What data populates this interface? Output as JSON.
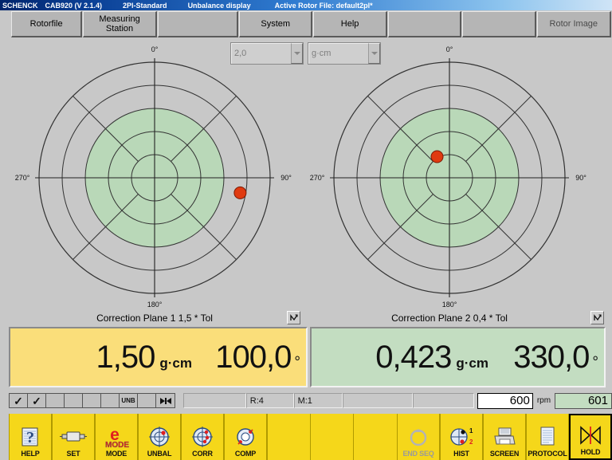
{
  "titlebar": {
    "brand": "SCHENCK",
    "app": "CAB920 (V 2.1.4)",
    "standard": "2Pl-Standard",
    "mode": "Unbalance display",
    "file": "Active Rotor File: default2pl*"
  },
  "menu": {
    "items": [
      {
        "label": "Rotorfile",
        "enabled": true
      },
      {
        "label": "Measuring\nStation",
        "enabled": true
      },
      {
        "label": "",
        "enabled": false
      },
      {
        "label": "System",
        "enabled": true
      },
      {
        "label": "Help",
        "enabled": true
      },
      {
        "label": "",
        "enabled": false
      },
      {
        "label": "",
        "enabled": false
      },
      {
        "label": "Rotor Image",
        "enabled": true
      }
    ]
  },
  "toolbar_top": {
    "tolerance_select": {
      "value": "2,0",
      "icon": "chevron-down-icon"
    },
    "unit_select": {
      "value": "g·cm",
      "icon": "chevron-down-icon"
    }
  },
  "plots": {
    "plane1": {
      "caption": "Correction Plane 1   1,5 * Tol",
      "labels": {
        "top": "0°",
        "right": "90°",
        "bottom": "180°",
        "left": "270°"
      },
      "trend_icon": "trend-chart-icon"
    },
    "plane2": {
      "caption": "Correction Plane 2   0,4 * Tol",
      "labels": {
        "top": "0°",
        "right": "90°",
        "bottom": "180°",
        "left": "270°"
      },
      "trend_icon": "trend-chart-icon"
    }
  },
  "readouts": {
    "plane1": {
      "amount": "1,50",
      "unit": "g·cm",
      "angle": "100,0",
      "degree": "°",
      "color": "#fade7a"
    },
    "plane2": {
      "amount": "0,423",
      "unit": "g·cm",
      "angle": "330,0",
      "degree": "°",
      "color": "#c3ddc1"
    }
  },
  "statusbar": {
    "cells": [
      "✓",
      "✓",
      "",
      "",
      "",
      "",
      "UNB",
      "",
      "▶◀"
    ],
    "blank1": "",
    "run": "R:4",
    "measurement": "M:1",
    "blank2": "",
    "blank3": "",
    "rpm_setpoint": "600",
    "rpm_label": "rpm",
    "rpm_actual": "601"
  },
  "bottom_toolbar": {
    "buttons": [
      {
        "label": "HELP",
        "icon": "help-question-icon",
        "state": "normal"
      },
      {
        "label": "SET",
        "icon": "rotor-set-icon",
        "state": "normal"
      },
      {
        "label": "MODE",
        "icon": "e-mode-icon",
        "state": "normal"
      },
      {
        "label": "UNBAL",
        "icon": "unbalance-target-icon",
        "state": "normal"
      },
      {
        "label": "CORR",
        "icon": "correction-target-icon",
        "state": "normal"
      },
      {
        "label": "COMP",
        "icon": "compensation-icon",
        "state": "normal"
      },
      {
        "label": "",
        "icon": "",
        "state": "blank"
      },
      {
        "label": "",
        "icon": "",
        "state": "blank"
      },
      {
        "label": "",
        "icon": "",
        "state": "blank"
      },
      {
        "label": "END SEQ",
        "icon": "end-sequence-icon",
        "state": "disabled"
      },
      {
        "label": "HIST",
        "icon": "history-icon",
        "state": "normal"
      },
      {
        "label": "SCREEN",
        "icon": "printer-icon",
        "state": "normal"
      },
      {
        "label": "PROTOCOL",
        "icon": "document-icon",
        "state": "normal"
      },
      {
        "label": "HOLD",
        "icon": "hold-icon",
        "state": "selected"
      }
    ]
  },
  "chart_data": [
    {
      "type": "scatter",
      "coordinate_system": "polar",
      "title": "Correction Plane 1   1,5 * Tol",
      "angle_ticks": [
        "0°",
        "90°",
        "180°",
        "270°"
      ],
      "rings": 5,
      "tolerance_ring_radius_fraction": 0.6,
      "tolerance_color": "#b9d8b8",
      "points": [
        {
          "angle_deg": 100.0,
          "amount": 1.5,
          "unit": "g·cm",
          "radius_fraction": 0.75,
          "color": "#e03a10"
        }
      ],
      "grid": true,
      "legend": "none"
    },
    {
      "type": "scatter",
      "coordinate_system": "polar",
      "title": "Correction Plane 2   0,4 * Tol",
      "angle_ticks": [
        "0°",
        "90°",
        "180°",
        "270°"
      ],
      "rings": 5,
      "tolerance_ring_radius_fraction": 0.6,
      "tolerance_color": "#b9d8b8",
      "points": [
        {
          "angle_deg": 330.0,
          "amount": 0.423,
          "unit": "g·cm",
          "radius_fraction": 0.2,
          "color": "#e03a10"
        }
      ],
      "grid": true,
      "legend": "none"
    }
  ]
}
